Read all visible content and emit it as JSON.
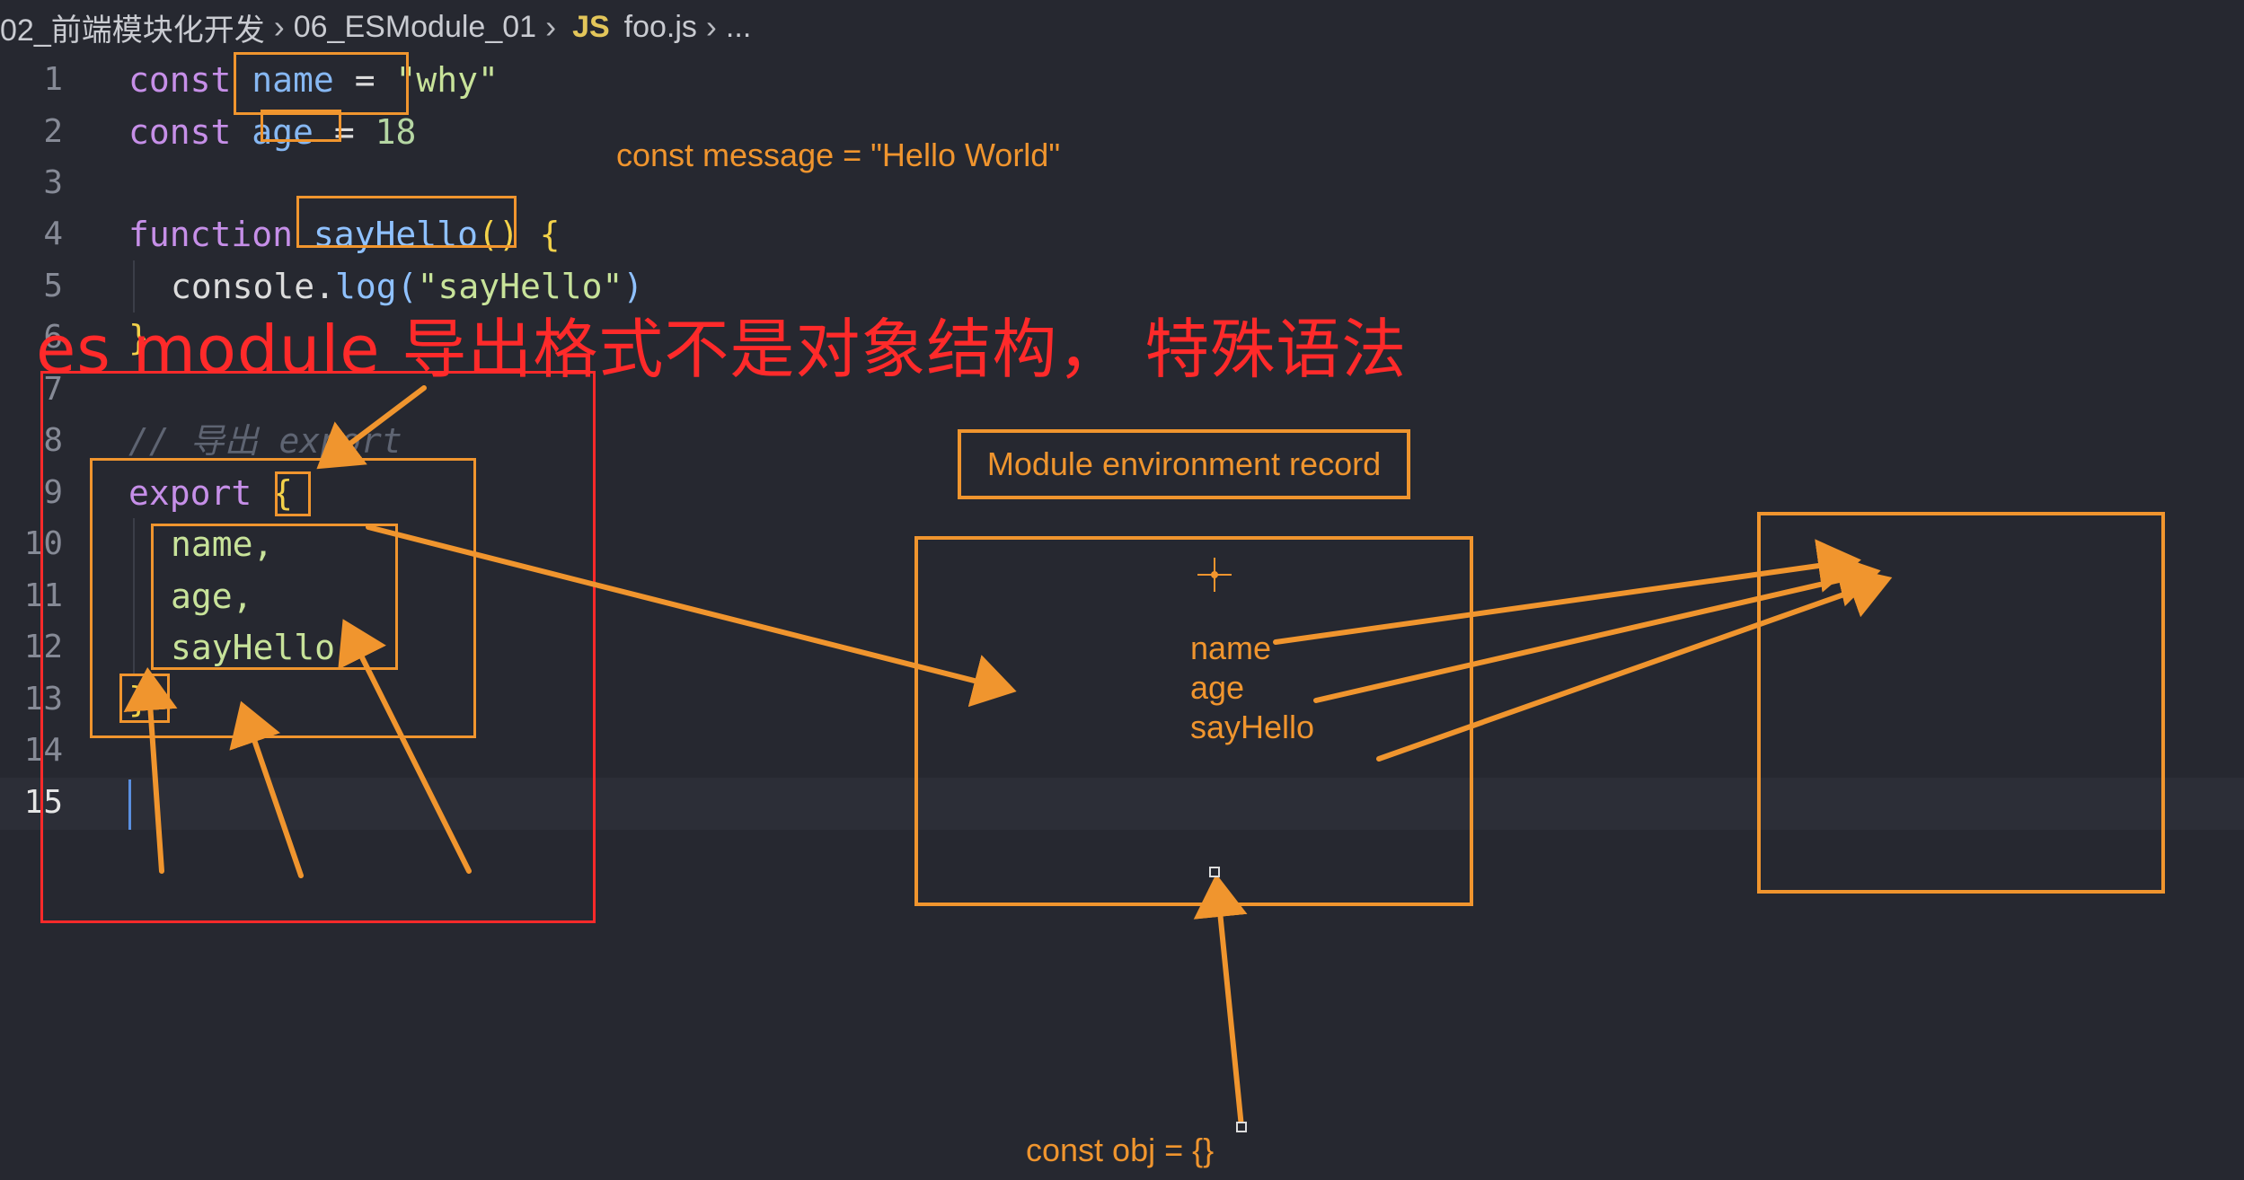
{
  "breadcrumb": {
    "folder": "02_前端模块化开发",
    "subfolder": "06_ESModule_01",
    "file_icon": "JS",
    "file": "foo.js",
    "ellipsis": "..."
  },
  "code": {
    "line_numbers": [
      "1",
      "2",
      "3",
      "4",
      "5",
      "6",
      "7",
      "8",
      "9",
      "10",
      "11",
      "12",
      "13",
      "14",
      "15"
    ],
    "active_line": "15",
    "lines": {
      "l1": {
        "kw": "const",
        "var": "name",
        "op": "=",
        "str": "\"why\""
      },
      "l2": {
        "kw": "const",
        "var": "age",
        "op": "=",
        "num": "18"
      },
      "l4": {
        "kw": "function",
        "fn": "sayHello",
        "paren": "()",
        "brace": "{"
      },
      "l5": {
        "obj": "console",
        "dot": ".",
        "method": "log",
        "open": "(",
        "str": "\"sayHello\"",
        "close": ")"
      },
      "l6": {
        "brace": "}"
      },
      "l8": {
        "comment": "// 导出 export"
      },
      "l9": {
        "kw": "export",
        "brace": "{"
      },
      "l10": {
        "text": "name,"
      },
      "l11": {
        "text": "age,"
      },
      "l12": {
        "text": "sayHello"
      },
      "l13": {
        "brace": "}"
      }
    }
  },
  "annotations": {
    "title": "es module 导出格式不是对象结构， 特殊语法",
    "const_message": "const message = \"Hello World\"",
    "record_label": "Module environment record",
    "env_items": [
      "name",
      "age",
      "sayHello"
    ],
    "const_obj": "const obj = {}"
  },
  "colors": {
    "background": "#262830",
    "annotation_orange": "#f0952e",
    "annotation_red": "#ff2a2a",
    "keyword": "#c68fe8",
    "string": "#c8e39a"
  }
}
